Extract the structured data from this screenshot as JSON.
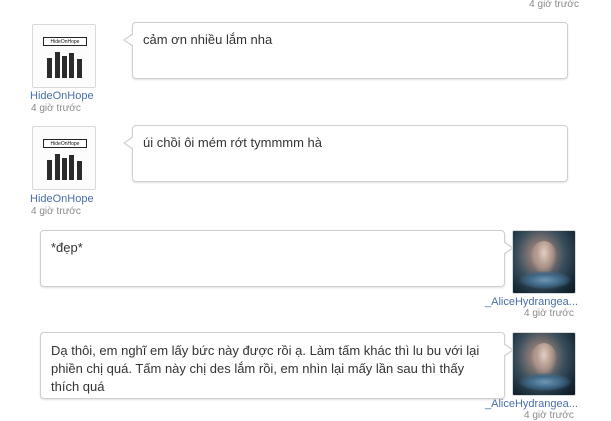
{
  "top_timestamp": "4 giờ trước",
  "messages": [
    {
      "author": "HideOnHope",
      "time": "4 giờ trước",
      "text": "cảm ơn nhiều lắm nha",
      "avatar_text": "HideOnHope",
      "avatar_icon": "hideonhope-logo"
    },
    {
      "author": "HideOnHope",
      "time": "4 giờ trước",
      "text": "úi chồi ôi mém rớt tymmmm hà",
      "avatar_text": "HideOnHope",
      "avatar_icon": "hideonhope-logo"
    },
    {
      "author": "_AliceHydrangea...",
      "time": "4 giờ trước",
      "text": "*đẹp*",
      "avatar_icon": "alice-portrait"
    },
    {
      "author": "_AliceHydrangea...",
      "time": "4 giờ trước",
      "text": "Dạ thôi, em nghĩ em lấy bức này được rồi ạ. Làm tấm khác thì lu bu với lại phiền chị quá. Tấm này chị des lắm rồi, em nhìn lại mấy lần sau thì thấy thích quá",
      "avatar_icon": "alice-portrait"
    }
  ],
  "colors": {
    "username": "#4a6ea8",
    "timestamp": "#8a8a8a",
    "bubble_border": "#cfcfcf",
    "message_text": "#333333"
  }
}
